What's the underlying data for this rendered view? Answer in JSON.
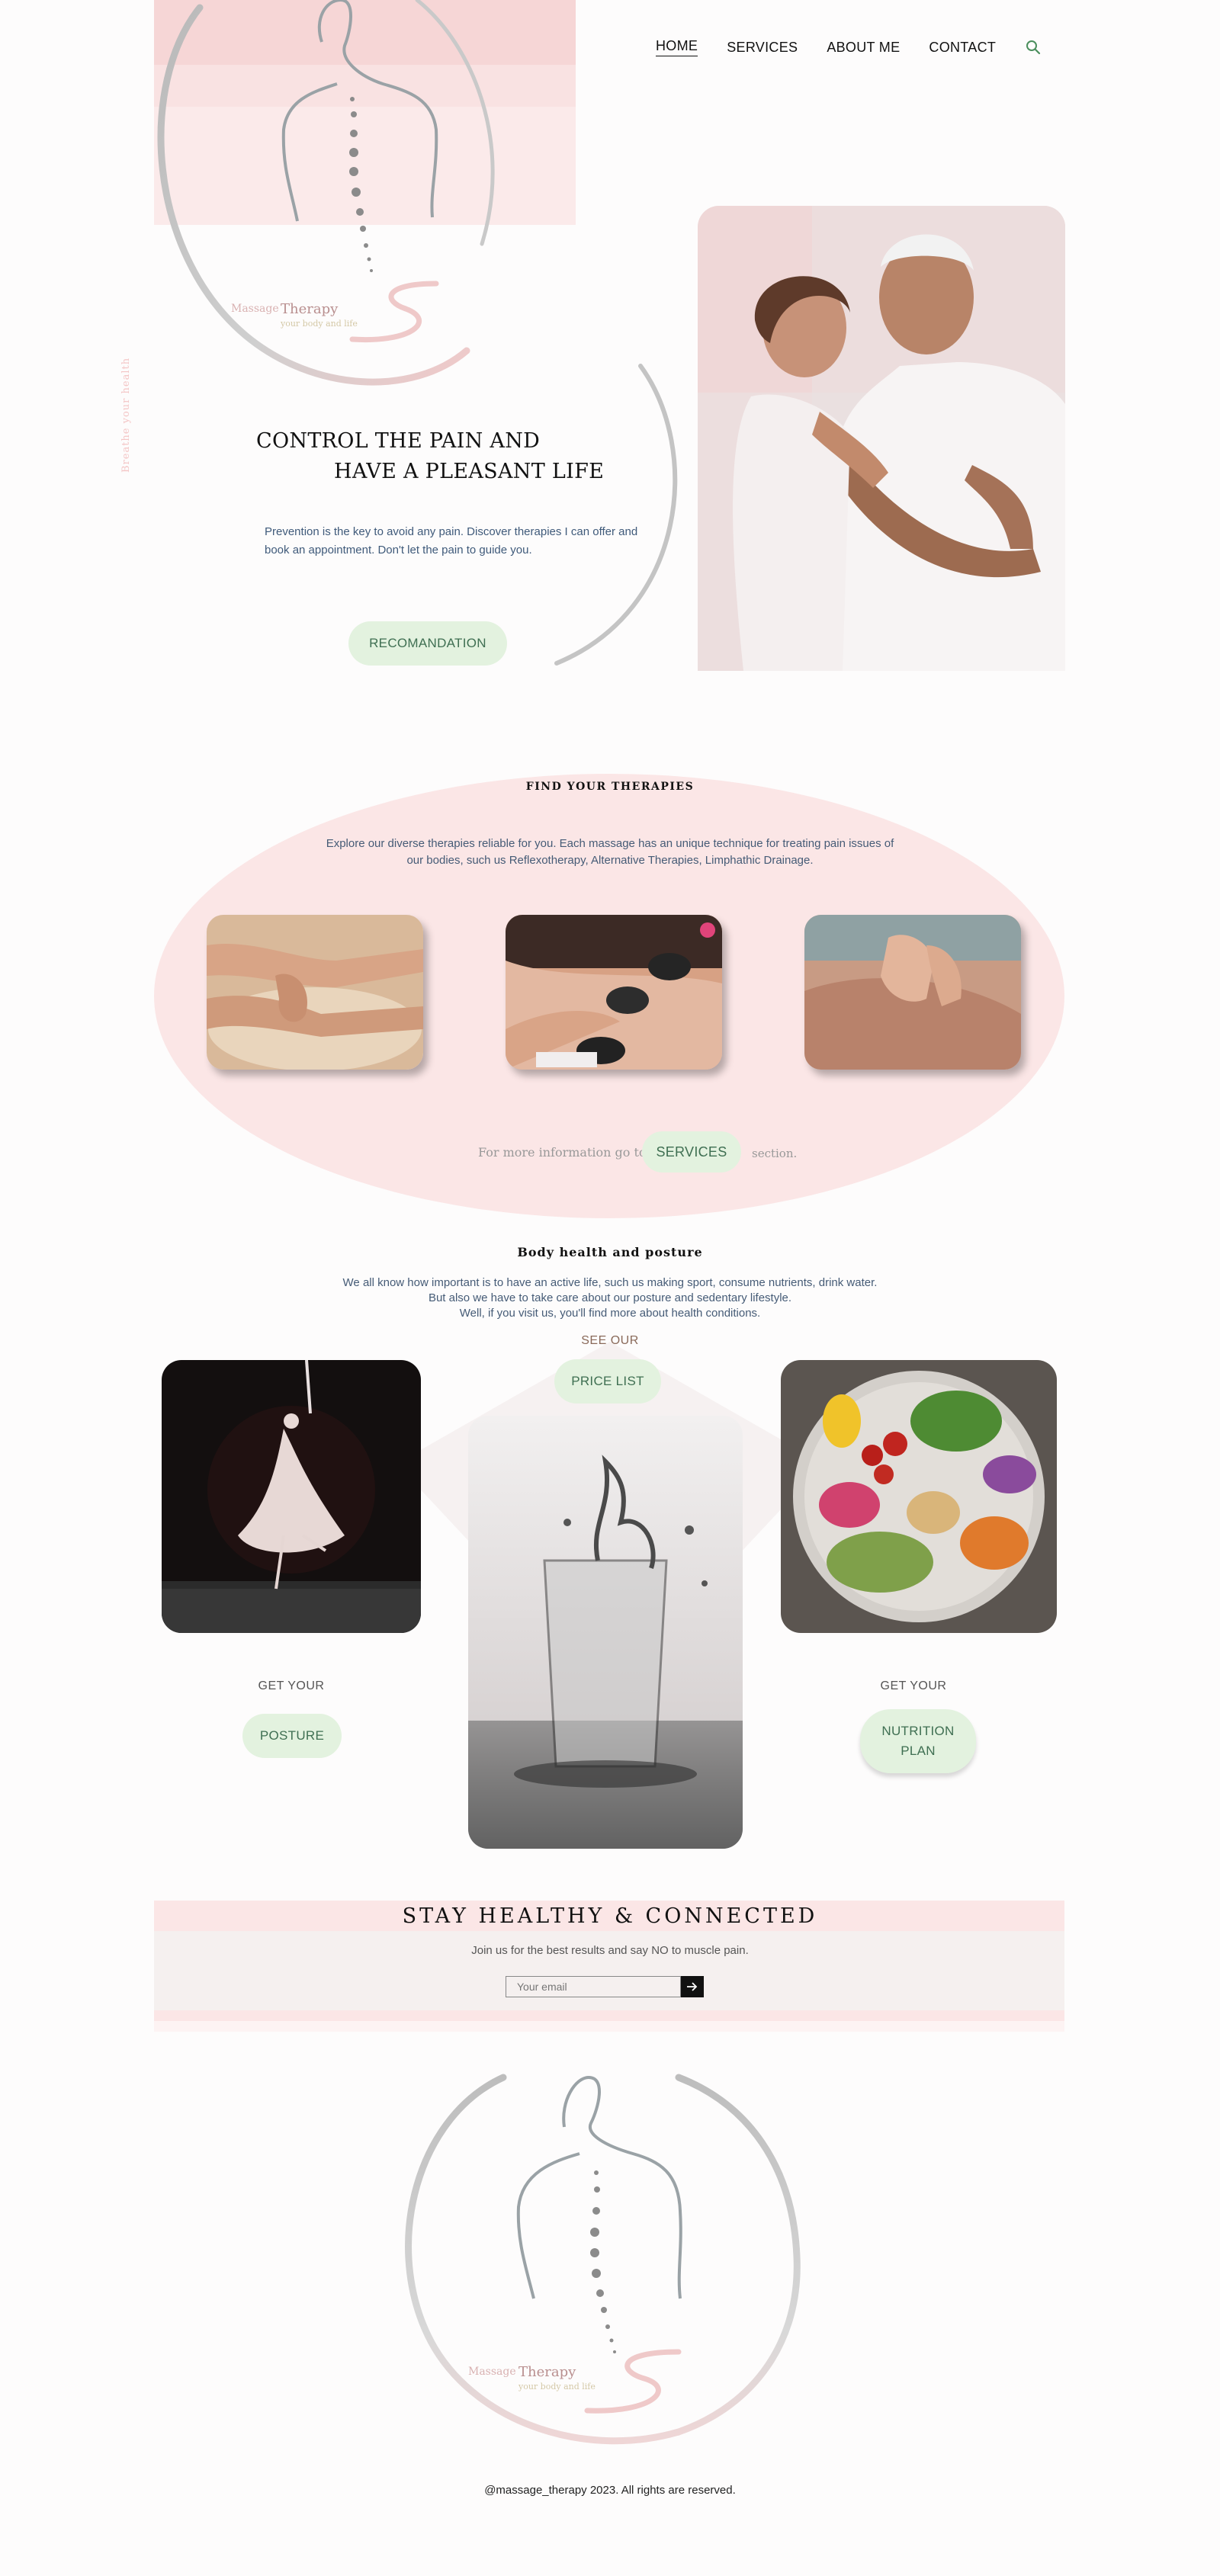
{
  "nav": {
    "items": [
      {
        "label": "HOME",
        "active": true
      },
      {
        "label": "SERVICES"
      },
      {
        "label": "ABOUT ME"
      },
      {
        "label": "CONTACT"
      }
    ],
    "search_icon": "search-icon"
  },
  "logo": {
    "brand_word1": "Massage",
    "brand_word2": "Therapy",
    "tagline": "your body and life"
  },
  "hero": {
    "title_line1": "CONTROL THE PAIN AND",
    "title_line2": "HAVE A PLEASANT LIFE",
    "vertical_text": "Breathe your health",
    "description": "Prevention is the key to avoid any pain. Discover therapies I can offer and book an appointment. Don't let the pain to guide you.",
    "button": "RECOMANDATION"
  },
  "therapies": {
    "heading": "FIND YOUR THERAPIES",
    "description_line1": "Explore our diverse therapies reliable for you. Each massage has an unique technique for treating pain issues of",
    "description_line2": "our bodies, such us Reflexotherapy, Alternative Therapies, Limphathic Drainage.",
    "more_prefix": "For more information go to",
    "more_button": "SERVICES",
    "more_suffix": "section."
  },
  "body_health": {
    "heading": "Body health and posture",
    "line1": "We all know how important is to have an active life, such us making sport, consume nutrients, drink water.",
    "line2": "But also we have to take care about our posture and sedentary lifestyle.",
    "line3": "Well, if you visit us, you'll find more about health conditions.",
    "see_our": "SEE OUR",
    "price_button": "PRICE LIST",
    "get_your_left": "GET YOUR",
    "posture_button": "POSTURE",
    "get_your_right": "GET YOUR",
    "nutrition_line1": "NUTRITION",
    "nutrition_line2": "PLAN"
  },
  "newsletter": {
    "heading": "STAY HEALTHY & CONNECTED",
    "subtext": "Join us for the best results and say NO to muscle pain.",
    "email_placeholder": "Your email",
    "submit_icon": "arrow-right-icon"
  },
  "footer": {
    "copyright": "@massage_therapy 2023. All rights are reserved."
  },
  "colors": {
    "pink": "#fbe6e6",
    "mint_button": "#e3f2df",
    "mint_text": "#3f6f52",
    "text_blue": "#455b76"
  }
}
